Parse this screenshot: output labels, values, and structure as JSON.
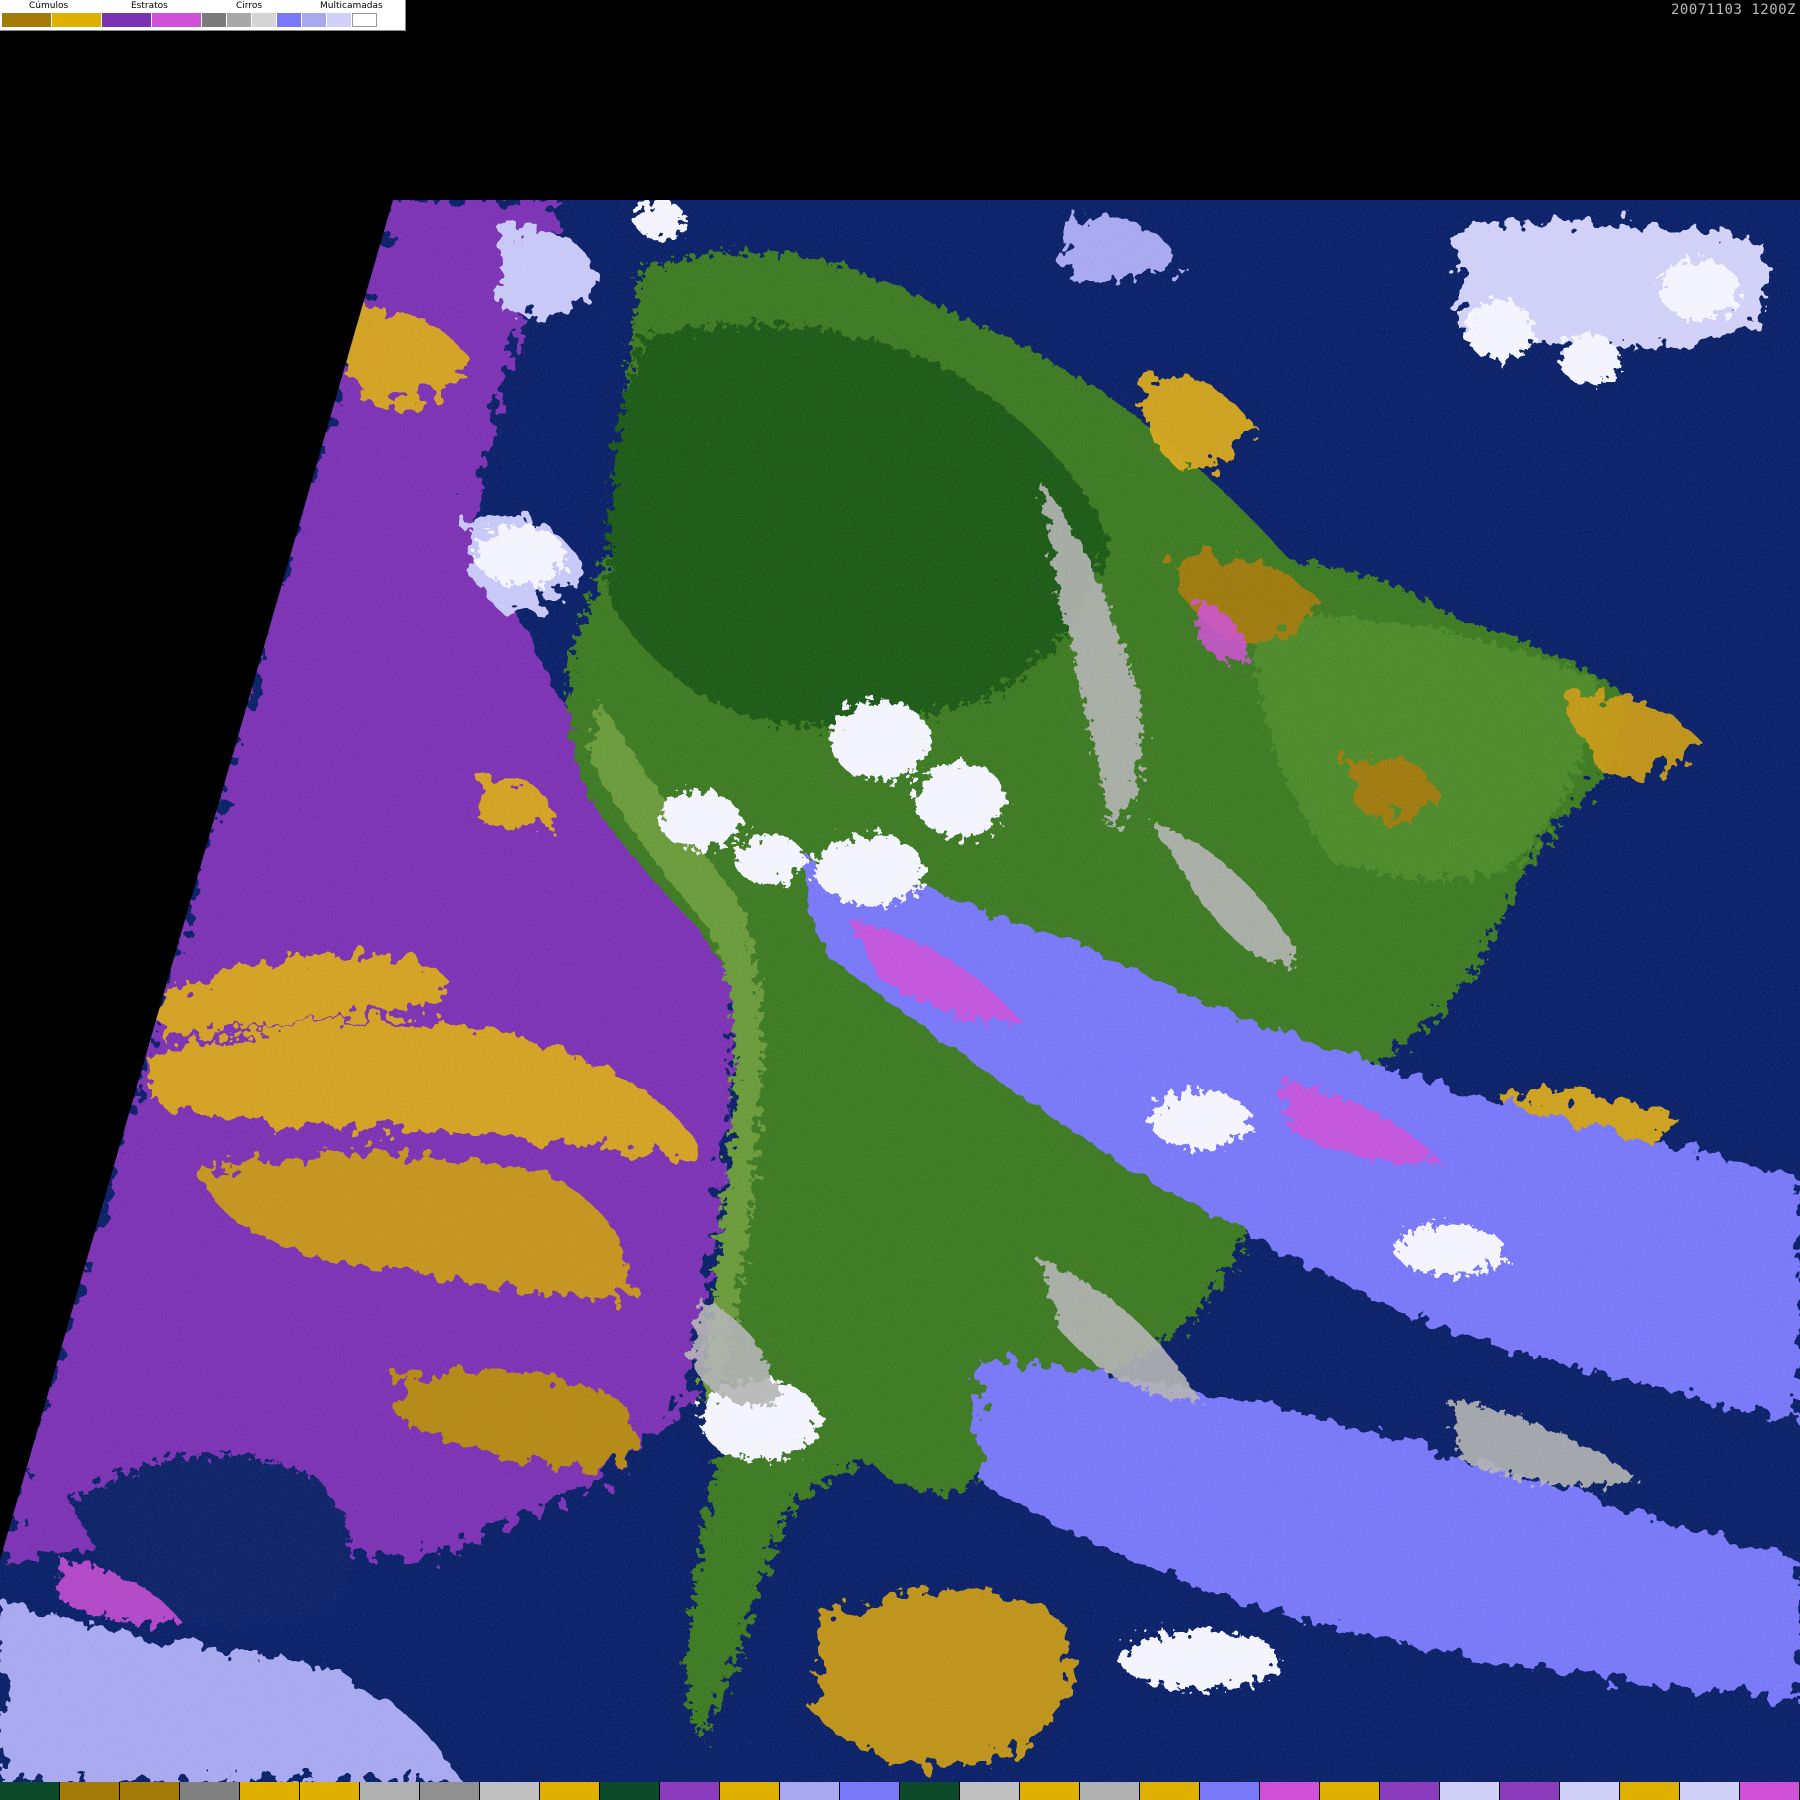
{
  "legend": {
    "groups": [
      {
        "label": "Cúmulos",
        "colors": [
          "#a47a08",
          "#e0b000"
        ]
      },
      {
        "label": "Estratos",
        "colors": [
          "#7a32b0",
          "#d050d8"
        ]
      },
      {
        "label": "Cirros",
        "colors": [
          "#7a7a7a",
          "#a8a8a8",
          "#d4d4d4"
        ]
      },
      {
        "label": "Multicamadas",
        "colors": [
          "#7878f8",
          "#a8a8f0",
          "#d0d0f8",
          "#ffffff"
        ]
      }
    ]
  },
  "timestamp": "20071103 1200Z",
  "colors": {
    "background": "#000000",
    "ocean": "#0a2068",
    "land_dark": "#1f5a12",
    "land": "#3d7a22",
    "land_light": "#5a8a30",
    "stratus": "#7b30b4",
    "stratus_pink": "#d050d8",
    "cumulus": "#d8a81c",
    "cumulus_dark": "#a47a08",
    "cirrus": "#b4b4b4",
    "multilayer": "#7878f8",
    "multilayer_light": "#c8c8f8",
    "white": "#ffffff"
  },
  "bottom_bar": [
    "#0d4a2a",
    "#a47a08",
    "#a47a08",
    "#808080",
    "#e0b000",
    "#e0b000",
    "#b0b0b0",
    "#909090",
    "#c0c0c0",
    "#e0b000",
    "#0d4a2a",
    "#8a3cbc",
    "#e0b000",
    "#a8a8f0",
    "#7878f8",
    "#0d4a2a",
    "#c0c0c0",
    "#e0b000",
    "#b0b0b0",
    "#e0b000",
    "#7878f8",
    "#d050d8",
    "#e0b000",
    "#8a3cbc",
    "#d0d0f8",
    "#8a3cbc",
    "#d0d0f8",
    "#e0b000",
    "#d0d0f8",
    "#d050d8"
  ]
}
